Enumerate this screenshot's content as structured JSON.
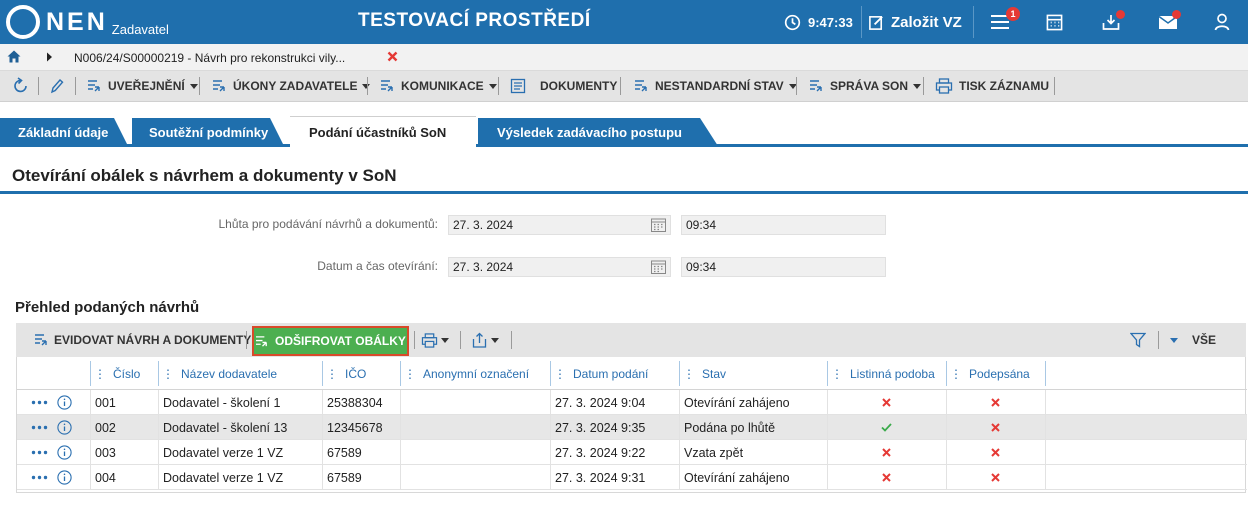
{
  "header": {
    "logo_text": "NEN",
    "logo_sub": "Zadavatel",
    "env_title": "TESTOVACÍ PROSTŘEDÍ",
    "clock": "9:47:33",
    "create_label": "Založit VZ",
    "menu_badge": "1",
    "colors": {
      "brand": "#1f6fad",
      "badge": "#e53935"
    }
  },
  "breadcrumb": {
    "text": "N006/24/S00000219 - Návrh pro rekonstrukci vily..."
  },
  "toolbar": {
    "uverejneni": "UVEŘEJNĚNÍ",
    "ukony": "ÚKONY ZADAVATELE",
    "komunikace": "KOMUNIKACE",
    "dokumenty": "DOKUMENTY",
    "nestandardni": "NESTANDARDNÍ STAV",
    "sprava": "SPRÁVA SON",
    "tisk": "TISK ZÁZNAMU"
  },
  "tabs": [
    {
      "label": "Základní údaje",
      "active": false
    },
    {
      "label": "Soutěžní podmínky",
      "active": false
    },
    {
      "label": "Podání účastníků SoN",
      "active": true
    },
    {
      "label": "Výsledek zadávacího postupu",
      "active": false
    }
  ],
  "section": {
    "title": "Otevírání obálek s návrhem a dokumenty v SoN"
  },
  "form": {
    "deadline_label": "Lhůta pro podávání návrhů a dokumentů:",
    "deadline_date": "27. 3. 2024",
    "deadline_time": "09:34",
    "opening_label": "Datum a čas otevírání:",
    "opening_date": "27. 3. 2024",
    "opening_time": "09:34"
  },
  "grid": {
    "title": "Přehled podaných návrhů",
    "evidovat_label": "EVIDOVAT NÁVRH A DOKUMENTY",
    "odsifrovat_label": "ODŠIFROVAT OBÁLKY",
    "filter_all_label": "VŠE",
    "columns": [
      "Číslo",
      "Název dodavatele",
      "IČO",
      "Anonymní označení",
      "Datum podání",
      "Stav",
      "Listinná podoba",
      "Podepsána"
    ],
    "rows": [
      {
        "cislo": "001",
        "nazev": "Dodavatel - školení 1",
        "ico": "25388304",
        "anonym": "",
        "datum": "27. 3. 2024 9:04",
        "stav": "Otevírání zahájeno",
        "listinna": "no",
        "podepsana": "no",
        "highlighted": false
      },
      {
        "cislo": "002",
        "nazev": "Dodavatel - školení 13",
        "ico": "12345678",
        "anonym": "",
        "datum": "27. 3. 2024 9:35",
        "stav": "Podána po lhůtě",
        "listinna": "yes",
        "podepsana": "no",
        "highlighted": true
      },
      {
        "cislo": "003",
        "nazev": "Dodavatel verze 1 VZ",
        "ico": "67589",
        "anonym": "",
        "datum": "27. 3. 2024 9:22",
        "stav": "Vzata zpět",
        "listinna": "no",
        "podepsana": "no",
        "highlighted": false
      },
      {
        "cislo": "004",
        "nazev": "Dodavatel verze 1 VZ",
        "ico": "67589",
        "anonym": "",
        "datum": "27. 3. 2024 9:31",
        "stav": "Otevírání zahájeno",
        "listinna": "no",
        "podepsana": "no",
        "highlighted": false
      }
    ]
  }
}
